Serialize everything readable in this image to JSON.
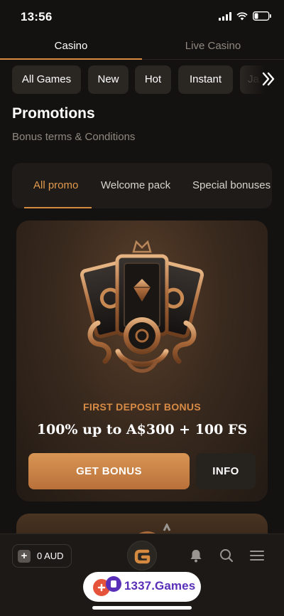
{
  "status_bar": {
    "time": "13:56"
  },
  "top_tabs": [
    {
      "label": "Casino",
      "active": true
    },
    {
      "label": "Live Casino",
      "active": false
    }
  ],
  "categories": [
    "All Games",
    "New",
    "Hot",
    "Instant",
    "Ja"
  ],
  "page": {
    "title": "Promotions",
    "terms_link": "Bonus terms & Conditions"
  },
  "promo_tabs": [
    {
      "label": "All promo",
      "active": true
    },
    {
      "label": "Welcome pack",
      "active": false
    },
    {
      "label": "Special bonuses",
      "active": false
    }
  ],
  "promo_card": {
    "subtitle": "FIRST DEPOSIT BONUS",
    "title": "100% up to A$300 + 100 FS",
    "primary_button": "GET BONUS",
    "secondary_button": "INFO"
  },
  "bottom_bar": {
    "balance": "0 AUD"
  },
  "brand_badge": {
    "text": "1337.Games"
  },
  "colors": {
    "accent": "#d58a3f",
    "background": "#141210",
    "card": "#1e1b18",
    "brand": "#5a2fb8"
  },
  "icons": [
    "signal-icon",
    "wifi-icon",
    "battery-icon",
    "double-chevron-right-icon",
    "emblem-icon",
    "plus-icon",
    "logo-icon",
    "bell-icon",
    "search-icon",
    "menu-icon"
  ]
}
